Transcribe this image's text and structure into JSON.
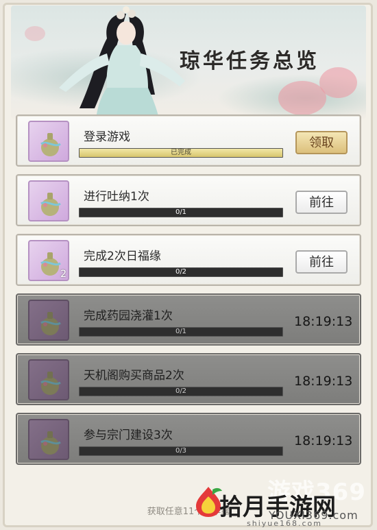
{
  "header": {
    "title": "琼华任务总览"
  },
  "tasks": [
    {
      "name": "登录游戏",
      "progress_text": "已完成",
      "progress": 1.0,
      "action": "领取",
      "state": "claimable",
      "count": ""
    },
    {
      "name": "进行吐纳1次",
      "progress_text": "0/1",
      "progress": 0,
      "action": "前往",
      "state": "active",
      "count": ""
    },
    {
      "name": "完成2次日福缘",
      "progress_text": "0/2",
      "progress": 0,
      "action": "前往",
      "state": "active",
      "count": "2"
    },
    {
      "name": "完成药园浇灌1次",
      "progress_text": "0/1",
      "progress": 0,
      "timer": "18:19:13",
      "state": "locked",
      "count": ""
    },
    {
      "name": "天机阁购买商品2次",
      "progress_text": "0/2",
      "progress": 0,
      "timer": "18:19:13",
      "state": "locked",
      "count": ""
    },
    {
      "name": "参与宗门建设3次",
      "progress_text": "0/3",
      "progress": 0,
      "timer": "18:19:13",
      "state": "locked",
      "count": ""
    }
  ],
  "footer": {
    "text": "获取任意11个玉华露"
  },
  "watermark": {
    "brand": "游戏369",
    "site_name": "拾月手游网",
    "url": "YOUXI369.com",
    "url2": "shiyue168.com"
  },
  "colors": {
    "claim_button": "#dcc07c",
    "progress_fill": "#d7c56d",
    "locked_card": "#7d7d7b",
    "icon_frame": "#cfa9dd"
  }
}
